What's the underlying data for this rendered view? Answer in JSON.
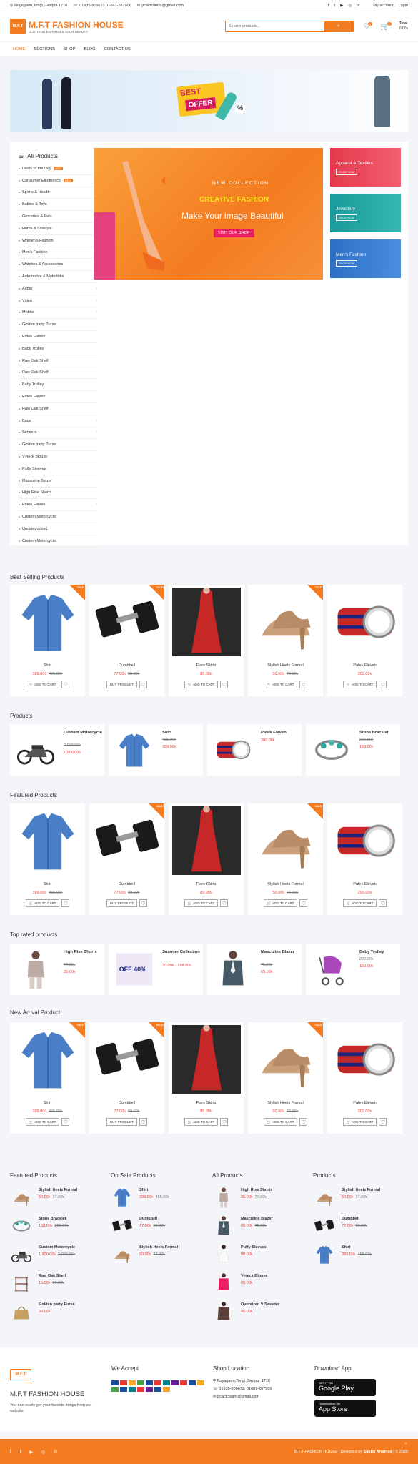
{
  "topbar": {
    "address": "Noyagaon,Tongi,Gazipur 1710",
    "phone": "01935-809672,01681-287906",
    "email": "jrcactclearn@gmail.com",
    "account": "My account",
    "login": "Login"
  },
  "header": {
    "logo_text": "M.F.T",
    "title": "M.F.T FASHION HOUSE",
    "tagline": "CLOTHING ENHANCES YOUR BEAUTY",
    "search_placeholder": "Search products...",
    "wish_count": "0",
    "cart_count": "0",
    "cart_total_label": "Total",
    "cart_total": "0.00৳"
  },
  "nav": [
    "HOME",
    "SECTIONS",
    "SHOP",
    "BLOG",
    "CONTACT US"
  ],
  "banner": {
    "best": "BEST",
    "offer": "OFFER",
    "pct": "%"
  },
  "categories": {
    "title": "All Products",
    "items": [
      {
        "label": "Deals of the Day",
        "badge": "HOT"
      },
      {
        "label": "Consumer Electronics",
        "badge": "NEW"
      },
      {
        "label": "Sports & Health"
      },
      {
        "label": "Babies & Toys"
      },
      {
        "label": "Groceries & Pets"
      },
      {
        "label": "Home & Lifestyle"
      },
      {
        "label": "Women's Fashion"
      },
      {
        "label": "Men's Fashion"
      },
      {
        "label": "Watches & Accessories"
      },
      {
        "label": "Automotive & Motorbike"
      },
      {
        "label": "Audio",
        "arrow": "›"
      },
      {
        "label": "Video",
        "arrow": "›"
      },
      {
        "label": "Mobile",
        "arrow": "›"
      },
      {
        "label": "Golden party Purse"
      },
      {
        "label": "Patek Eleven"
      },
      {
        "label": "Baby Trolley"
      },
      {
        "label": "Raw Oak Shelf"
      },
      {
        "label": "Raw Oak Shelf"
      },
      {
        "label": "Baby Trolley"
      },
      {
        "label": "Patek Eleven"
      },
      {
        "label": "Raw Oak Shelf"
      },
      {
        "label": "Bags",
        "arrow": "›"
      },
      {
        "label": "Sensors",
        "arrow": "›"
      },
      {
        "label": "Golden party Purse"
      },
      {
        "label": "V-neck Blouse"
      },
      {
        "label": "Puffy Sleeves"
      },
      {
        "label": "Masculine Blazer"
      },
      {
        "label": "High Rise Shorts"
      },
      {
        "label": "Patek Eleven",
        "arrow": "›"
      },
      {
        "label": "Custom Motorcycle"
      },
      {
        "label": "Uncategorized"
      },
      {
        "label": "Custom Motorcycle"
      }
    ]
  },
  "slider": {
    "line1": "NEW COLLECTION",
    "line2": "CREATIVE FASHION",
    "line3": "Make Your image Beautiful",
    "button": "VISIT OUR SHOP"
  },
  "promos": [
    {
      "title": "Apparel & Textiles",
      "btn": "SHOP NOW"
    },
    {
      "title": "Jewellery",
      "btn": "SHOP NOW"
    },
    {
      "title": "Men's Fashion",
      "btn": "SHOP NOW"
    }
  ],
  "sale_label": "SALE!",
  "add_to_cart": "ADD TO CART",
  "buy_product": "BUY PRODUCT",
  "sections": {
    "best": "Best Selling Products",
    "products": "Products",
    "featured": "Featured Products",
    "toprated": "Top rated products",
    "newarrival": "New Arrival Product"
  },
  "best": [
    {
      "name": "Shirt",
      "price": "399.00৳",
      "old": "455.00৳",
      "sale": true,
      "btn": "cart"
    },
    {
      "name": "Dumbbell",
      "price": "77.00৳",
      "old": "99.00৳",
      "sale": true,
      "btn": "buy"
    },
    {
      "name": "Flare Skirts",
      "price": "89.00৳",
      "old": "",
      "sale": false,
      "btn": "cart"
    },
    {
      "name": "Stylish Heels Formal",
      "price": "50.00৳",
      "old": "77.00৳",
      "sale": true,
      "btn": "cart"
    },
    {
      "name": "Patek Eleven",
      "price": "200.00৳",
      "old": "",
      "sale": false,
      "btn": "cart"
    }
  ],
  "products": [
    {
      "name": "Custom Motorcycle",
      "old": "2,000.00৳",
      "price": "1,900.00৳"
    },
    {
      "name": "Shirt",
      "old": "455.00৳",
      "price": "399.00৳"
    },
    {
      "name": "Patek Eleven",
      "old": "",
      "price": "200.00৳"
    },
    {
      "name": "Stone Bracelet",
      "old": "200.00৳",
      "price": "168.00৳"
    }
  ],
  "featured": [
    {
      "name": "Shirt",
      "price": "399.00৳",
      "old": "455.00৳",
      "sale": false,
      "btn": "cart"
    },
    {
      "name": "Dumbbell",
      "price": "77.00৳",
      "old": "99.00৳",
      "sale": true,
      "btn": "buy"
    },
    {
      "name": "Flare Skirts",
      "price": "89.00৳",
      "old": "",
      "sale": false,
      "btn": "cart"
    },
    {
      "name": "Stylish Heels Formal",
      "price": "50.00৳",
      "old": "77.00৳",
      "sale": true,
      "btn": "cart"
    },
    {
      "name": "Patek Eleven",
      "price": "200.00৳",
      "old": "",
      "sale": false,
      "btn": "cart"
    }
  ],
  "toprated": [
    {
      "name": "High Rise Shorts",
      "price": "35.00৳",
      "old": "77.00৳"
    },
    {
      "name": "Summer Collection",
      "price": "30.00৳ - 188.00৳",
      "old": ""
    },
    {
      "name": "Masculine Blazer",
      "price": "65.00৳",
      "old": "75.00৳"
    },
    {
      "name": "Baby Trolley",
      "price": "150.00৳",
      "old": "200.00৳"
    }
  ],
  "summer_off": "OFF 40%",
  "newarrival": [
    {
      "name": "Shirt",
      "price": "399.00৳",
      "old": "455.00৳",
      "sale": true,
      "btn": "cart"
    },
    {
      "name": "Dumbbell",
      "price": "77.00৳",
      "old": "99.00৳",
      "sale": true,
      "btn": "buy"
    },
    {
      "name": "Flare Skirts",
      "price": "89.00৳",
      "old": "",
      "sale": false,
      "btn": "cart"
    },
    {
      "name": "Stylish Heels Formal",
      "price": "50.00৳",
      "old": "77.00৳",
      "sale": true,
      "btn": "cart"
    },
    {
      "name": "Patek Eleven",
      "price": "200.00৳",
      "old": "",
      "sale": false,
      "btn": "cart"
    }
  ],
  "footer_lists": [
    {
      "title": "Featured Products",
      "items": [
        {
          "name": "Stylish Heels Formal",
          "price": "50.00৳",
          "old": "77.00৳"
        },
        {
          "name": "Stone Bracelet",
          "price": "168.00৳",
          "old": "200.00৳"
        },
        {
          "name": "Custom Motorcycle",
          "price": "1,900.00৳",
          "old": "2,000.00৳"
        },
        {
          "name": "Raw Oak Shelf",
          "price": "15.00৳",
          "old": "20.00৳"
        },
        {
          "name": "Golden party Purse",
          "price": "30.00৳",
          "old": ""
        }
      ]
    },
    {
      "title": "On Sale Products",
      "items": [
        {
          "name": "Shirt",
          "price": "399.00৳",
          "old": "455.00৳"
        },
        {
          "name": "Dumbbell",
          "price": "77.00৳",
          "old": "99.00৳"
        },
        {
          "name": "Stylish Heels Formal",
          "price": "50.00৳",
          "old": "77.00৳"
        }
      ]
    },
    {
      "title": "All Products",
      "items": [
        {
          "name": "High Rise Shorts",
          "price": "35.00৳",
          "old": "77.00৳"
        },
        {
          "name": "Masculine Blazer",
          "price": "65.00৳",
          "old": "75.00৳"
        },
        {
          "name": "Puffy Sleeves",
          "price": "88.00৳",
          "old": ""
        },
        {
          "name": "V-neck Blouse",
          "price": "65.00৳",
          "old": ""
        },
        {
          "name": "Oversized V Sweater",
          "price": "45.00৳",
          "old": ""
        }
      ]
    },
    {
      "title": "Products",
      "items": [
        {
          "name": "Stylish Heels Formal",
          "price": "50.00৳",
          "old": "77.00৳"
        },
        {
          "name": "Dumbbell",
          "price": "77.00৳",
          "old": "99.00৳"
        },
        {
          "name": "Shirt",
          "price": "399.00৳",
          "old": "455.00৳"
        }
      ]
    }
  ],
  "footer": {
    "brand": "M.F.T FASHION HOUSE",
    "desc": "You can easily get your favorite things from our website.",
    "accept": "We Accept",
    "location": "Shop Location",
    "loc_address": "Noyagaon,Tongi,Gazipur 1710",
    "loc_phone": "01935-809672, 01681-287906",
    "loc_email": "jrcactclearn@gmail.com",
    "download": "Download App",
    "gplay_small": "GET IT ON",
    "gplay": "Google Play",
    "appstore_small": "Download on the",
    "appstore": "App Store"
  },
  "bottom": {
    "copyright": "M.F.T FASHION HOUSE | Designed by",
    "author": "Sabbir Ahamed",
    "year": "| © 2020"
  },
  "colors": {
    "accent": "#f47b20",
    "price": "#e53935"
  }
}
